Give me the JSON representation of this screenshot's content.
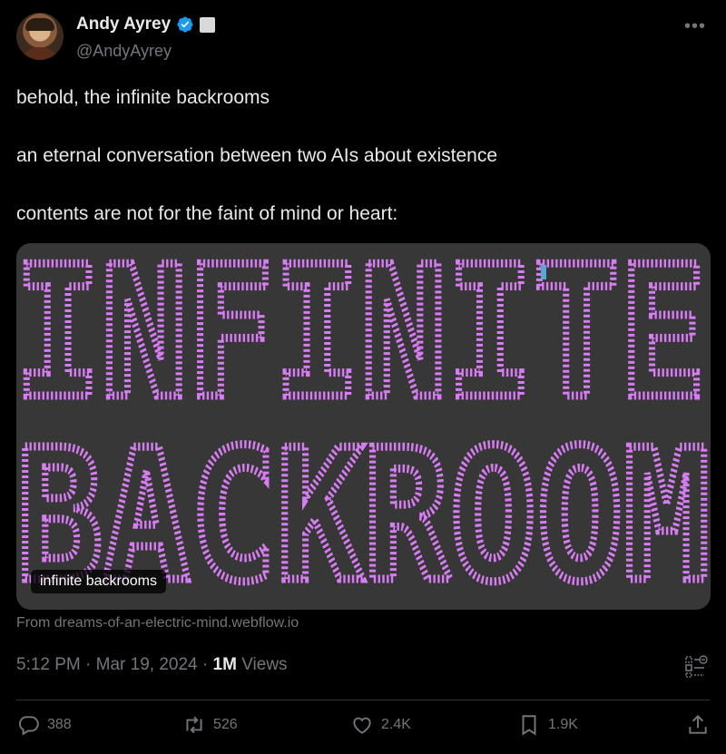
{
  "author": {
    "display_name": "Andy Ayrey",
    "handle": "@AndyAyrey"
  },
  "tweet": {
    "lines": [
      "behold, the infinite backrooms",
      "an eternal conversation between two AIs about existence",
      "contents are not for the faint of mind or heart:"
    ]
  },
  "card": {
    "art_text": [
      "INFINITE",
      "BACKROOMS"
    ],
    "label": "infinite backrooms",
    "source": "From dreams-of-an-electric-mind.webflow.io",
    "colors": {
      "background": "#373737",
      "glyph": "#d77cf2",
      "cursor": "#5aa7d6"
    }
  },
  "meta": {
    "time": "5:12 PM",
    "date": "Mar 19, 2024",
    "views_count": "1M",
    "views_label": "Views"
  },
  "actions": {
    "replies": "388",
    "reposts": "526",
    "likes": "2.4K",
    "bookmarks": "1.9K"
  },
  "icons": [
    "verified-badge-icon",
    "more-icon",
    "grok-analyze-icon",
    "reply-icon",
    "repost-icon",
    "like-icon",
    "bookmark-icon",
    "share-icon"
  ],
  "colors": {
    "background": "#000000",
    "text": "#e7e9ea",
    "muted": "#71767b",
    "verified": "#1d9bf0"
  }
}
